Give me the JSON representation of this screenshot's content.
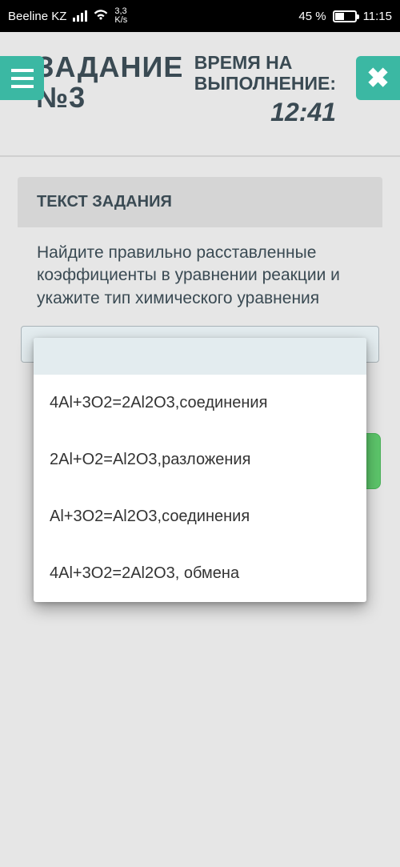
{
  "status": {
    "carrier": "Beeline KZ",
    "speed_top": "3,3",
    "speed_unit": "K/s",
    "battery_pct": "45 %",
    "time": "11:15"
  },
  "header": {
    "task_title_line1": "ЗАДАНИЕ",
    "task_title_line2": "№3",
    "timer_label_line1": "ВРЕМЯ НА",
    "timer_label_line2": "ВЫПОЛНЕНИЕ:",
    "timer_value": "12:41"
  },
  "card": {
    "header": "ТЕКСТ ЗАДАНИЯ",
    "prompt": "Найдите правильно расставленные коэффициенты в уравнении реакции и укажите тип химического уравнения"
  },
  "dropdown": {
    "options": [
      "4Al+3O2=2Al2O3,соединения",
      "2Al+O2=Al2O3,разложения",
      "Al+3O2=Al2O3,соединения",
      "4Al+3O2=2Al2O3, обмена"
    ]
  }
}
